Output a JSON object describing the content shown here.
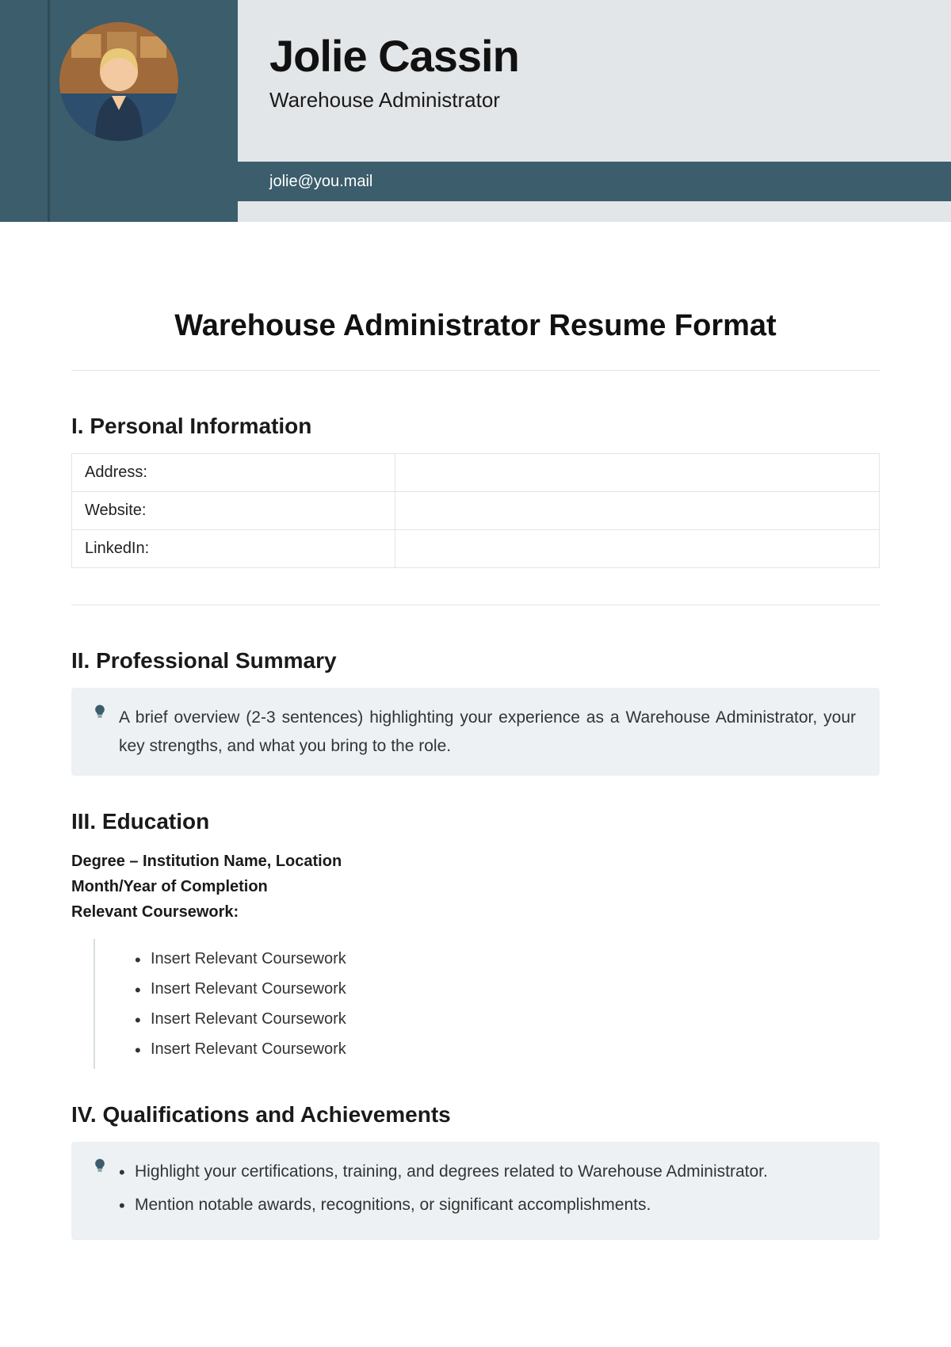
{
  "header": {
    "name": "Jolie Cassin",
    "role": "Warehouse Administrator",
    "email": "jolie@you.mail"
  },
  "doc_title": "Warehouse Administrator Resume Format",
  "sections": {
    "personal": {
      "heading": "I. Personal Information",
      "rows": [
        {
          "label": "Address:",
          "value": ""
        },
        {
          "label": "Website:",
          "value": ""
        },
        {
          "label": "LinkedIn:",
          "value": ""
        }
      ]
    },
    "summary": {
      "heading": "II. Professional Summary",
      "tip": "A brief overview (2-3 sentences) highlighting your experience as a Warehouse Administrator, your key strengths, and what you bring to the role."
    },
    "education": {
      "heading": "III. Education",
      "line1": "Degree – Institution Name, Location",
      "line2": "Month/Year of Completion",
      "line3": "Relevant Coursework:",
      "coursework": [
        "Insert Relevant Coursework",
        "Insert Relevant Coursework",
        "Insert Relevant Coursework",
        "Insert Relevant Coursework"
      ]
    },
    "qualifications": {
      "heading": "IV. Qualifications and Achievements",
      "tips": [
        "Highlight your certifications, training, and degrees related to Warehouse Administrator.",
        "Mention notable awards, recognitions, or significant accomplishments."
      ]
    }
  }
}
